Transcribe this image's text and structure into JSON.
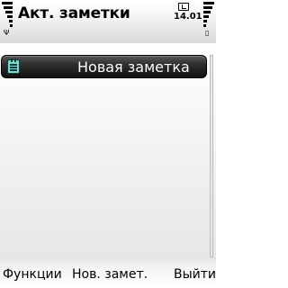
{
  "status": {
    "title": "Акт. заметки",
    "time": "14.01",
    "signal_symbol": "Ψ",
    "battery_symbol": "▯",
    "icons": [
      "signal-icon",
      "clock-icon",
      "battery-icon"
    ]
  },
  "list": {
    "items": [
      {
        "label": "Новая заметка",
        "icon": "note-icon",
        "selected": true
      }
    ]
  },
  "softkeys": {
    "left": "Функции",
    "middle": "Нов. замет.",
    "right": "Выйти"
  },
  "colors": {
    "highlight": "#1a1a1a",
    "highlight_text": "#ffffff",
    "note_icon": "#7fd6d0"
  }
}
